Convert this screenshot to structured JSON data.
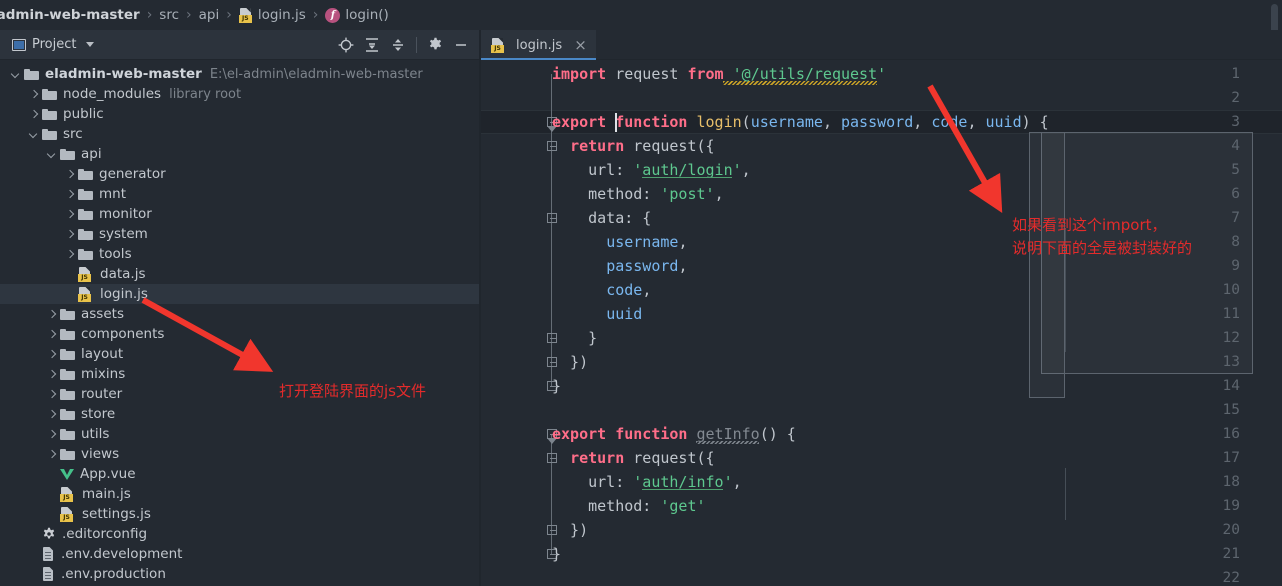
{
  "breadcrumb": {
    "root": "ladmin-web-master",
    "items": [
      "src",
      "api"
    ],
    "file": "login.js",
    "symbol": "login()",
    "separator": "›"
  },
  "project_toolbar": {
    "label": "Project",
    "icons": [
      "locate-icon",
      "expand-all-icon",
      "collapse-all-icon",
      "settings-gear-icon",
      "minimize-icon"
    ]
  },
  "tree": [
    {
      "indent": 0,
      "arrow": "down",
      "icon": "folder",
      "label": "eladmin-web-master",
      "bold": true,
      "sub": "E:\\el-admin\\eladmin-web-master",
      "selected": false
    },
    {
      "indent": 1,
      "arrow": "right",
      "icon": "folder",
      "label": "node_modules",
      "bold": false,
      "sub": "library root",
      "selected": false
    },
    {
      "indent": 1,
      "arrow": "right",
      "icon": "folder",
      "label": "public",
      "bold": false,
      "sub": "",
      "selected": false
    },
    {
      "indent": 1,
      "arrow": "down",
      "icon": "folder",
      "label": "src",
      "bold": false,
      "sub": "",
      "selected": false
    },
    {
      "indent": 2,
      "arrow": "down",
      "icon": "folder",
      "label": "api",
      "bold": false,
      "sub": "",
      "selected": false
    },
    {
      "indent": 3,
      "arrow": "right",
      "icon": "folder",
      "label": "generator",
      "bold": false,
      "sub": "",
      "selected": false
    },
    {
      "indent": 3,
      "arrow": "right",
      "icon": "folder",
      "label": "mnt",
      "bold": false,
      "sub": "",
      "selected": false
    },
    {
      "indent": 3,
      "arrow": "right",
      "icon": "folder",
      "label": "monitor",
      "bold": false,
      "sub": "",
      "selected": false
    },
    {
      "indent": 3,
      "arrow": "right",
      "icon": "folder",
      "label": "system",
      "bold": false,
      "sub": "",
      "selected": false
    },
    {
      "indent": 3,
      "arrow": "right",
      "icon": "folder",
      "label": "tools",
      "bold": false,
      "sub": "",
      "selected": false
    },
    {
      "indent": 3,
      "arrow": "none",
      "icon": "js",
      "label": "data.js",
      "bold": false,
      "sub": "",
      "selected": false
    },
    {
      "indent": 3,
      "arrow": "none",
      "icon": "js",
      "label": "login.js",
      "bold": false,
      "sub": "",
      "selected": true
    },
    {
      "indent": 2,
      "arrow": "right",
      "icon": "folder",
      "label": "assets",
      "bold": false,
      "sub": "",
      "selected": false
    },
    {
      "indent": 2,
      "arrow": "right",
      "icon": "folder",
      "label": "components",
      "bold": false,
      "sub": "",
      "selected": false
    },
    {
      "indent": 2,
      "arrow": "right",
      "icon": "folder",
      "label": "layout",
      "bold": false,
      "sub": "",
      "selected": false
    },
    {
      "indent": 2,
      "arrow": "right",
      "icon": "folder",
      "label": "mixins",
      "bold": false,
      "sub": "",
      "selected": false
    },
    {
      "indent": 2,
      "arrow": "right",
      "icon": "folder",
      "label": "router",
      "bold": false,
      "sub": "",
      "selected": false
    },
    {
      "indent": 2,
      "arrow": "right",
      "icon": "folder",
      "label": "store",
      "bold": false,
      "sub": "",
      "selected": false
    },
    {
      "indent": 2,
      "arrow": "right",
      "icon": "folder",
      "label": "utils",
      "bold": false,
      "sub": "",
      "selected": false
    },
    {
      "indent": 2,
      "arrow": "right",
      "icon": "folder",
      "label": "views",
      "bold": false,
      "sub": "",
      "selected": false
    },
    {
      "indent": 2,
      "arrow": "none",
      "icon": "vue",
      "label": "App.vue",
      "bold": false,
      "sub": "",
      "selected": false
    },
    {
      "indent": 2,
      "arrow": "none",
      "icon": "js",
      "label": "main.js",
      "bold": false,
      "sub": "",
      "selected": false
    },
    {
      "indent": 2,
      "arrow": "none",
      "icon": "js",
      "label": "settings.js",
      "bold": false,
      "sub": "",
      "selected": false
    },
    {
      "indent": 1,
      "arrow": "none",
      "icon": "gear",
      "label": ".editorconfig",
      "bold": false,
      "sub": "",
      "selected": false
    },
    {
      "indent": 1,
      "arrow": "none",
      "icon": "txt",
      "label": ".env.development",
      "bold": false,
      "sub": "",
      "selected": false
    },
    {
      "indent": 1,
      "arrow": "none",
      "icon": "txt",
      "label": ".env.production",
      "bold": false,
      "sub": "",
      "selected": false
    }
  ],
  "editor": {
    "tab": {
      "title": "login.js",
      "close": "×"
    },
    "current_line": 3,
    "lines": [
      {
        "n": 1,
        "tokens": [
          {
            "t": "import",
            "c": "k"
          },
          {
            "t": " request ",
            "c": "id"
          },
          {
            "t": "from",
            "c": "k"
          },
          {
            "t": " ",
            "c": "id"
          },
          {
            "t": "'@/utils/request'",
            "c": "s"
          }
        ]
      },
      {
        "n": 2,
        "tokens": []
      },
      {
        "n": 3,
        "tokens": [
          {
            "t": "export",
            "c": "k"
          },
          {
            "t": " ",
            "c": "id"
          },
          {
            "t": "function",
            "c": "k"
          },
          {
            "t": " ",
            "c": "id"
          },
          {
            "t": "login",
            "c": "fn"
          },
          {
            "t": "(",
            "c": "punct"
          },
          {
            "t": "username",
            "c": "p"
          },
          {
            "t": ", ",
            "c": "punct"
          },
          {
            "t": "password",
            "c": "p"
          },
          {
            "t": ", ",
            "c": "punct"
          },
          {
            "t": "code",
            "c": "p"
          },
          {
            "t": ", ",
            "c": "punct"
          },
          {
            "t": "uuid",
            "c": "p"
          },
          {
            "t": ") {",
            "c": "punct"
          }
        ]
      },
      {
        "n": 4,
        "tokens": [
          {
            "t": "  ",
            "c": "id"
          },
          {
            "t": "return",
            "c": "k"
          },
          {
            "t": " request({",
            "c": "id"
          }
        ]
      },
      {
        "n": 5,
        "tokens": [
          {
            "t": "    url: ",
            "c": "id"
          },
          {
            "t": "'auth/login'",
            "c": "s"
          },
          {
            "t": ",",
            "c": "punct"
          }
        ]
      },
      {
        "n": 6,
        "tokens": [
          {
            "t": "    method: ",
            "c": "id"
          },
          {
            "t": "'post'",
            "c": "s"
          },
          {
            "t": ",",
            "c": "punct"
          }
        ]
      },
      {
        "n": 7,
        "tokens": [
          {
            "t": "    data: {",
            "c": "id"
          }
        ]
      },
      {
        "n": 8,
        "tokens": [
          {
            "t": "      ",
            "c": "id"
          },
          {
            "t": "username",
            "c": "p"
          },
          {
            "t": ",",
            "c": "punct"
          }
        ]
      },
      {
        "n": 9,
        "tokens": [
          {
            "t": "      ",
            "c": "id"
          },
          {
            "t": "password",
            "c": "p"
          },
          {
            "t": ",",
            "c": "punct"
          }
        ]
      },
      {
        "n": 10,
        "tokens": [
          {
            "t": "      ",
            "c": "id"
          },
          {
            "t": "code",
            "c": "p"
          },
          {
            "t": ",",
            "c": "punct"
          }
        ]
      },
      {
        "n": 11,
        "tokens": [
          {
            "t": "      ",
            "c": "id"
          },
          {
            "t": "uuid",
            "c": "p"
          }
        ]
      },
      {
        "n": 12,
        "tokens": [
          {
            "t": "    }",
            "c": "punct"
          }
        ]
      },
      {
        "n": 13,
        "tokens": [
          {
            "t": "  })",
            "c": "punct"
          }
        ]
      },
      {
        "n": 14,
        "tokens": [
          {
            "t": "}",
            "c": "punct"
          }
        ]
      },
      {
        "n": 15,
        "tokens": []
      },
      {
        "n": 16,
        "tokens": [
          {
            "t": "export",
            "c": "k"
          },
          {
            "t": " ",
            "c": "id"
          },
          {
            "t": "function",
            "c": "k"
          },
          {
            "t": " ",
            "c": "id"
          },
          {
            "t": "getInfo",
            "c": "gray"
          },
          {
            "t": "() {",
            "c": "punct"
          }
        ]
      },
      {
        "n": 17,
        "tokens": [
          {
            "t": "  ",
            "c": "id"
          },
          {
            "t": "return",
            "c": "k"
          },
          {
            "t": " request({",
            "c": "id"
          }
        ]
      },
      {
        "n": 18,
        "tokens": [
          {
            "t": "    url: ",
            "c": "id"
          },
          {
            "t": "'auth/info'",
            "c": "s"
          },
          {
            "t": ",",
            "c": "punct"
          }
        ]
      },
      {
        "n": 19,
        "tokens": [
          {
            "t": "    method: ",
            "c": "id"
          },
          {
            "t": "'get'",
            "c": "s"
          }
        ]
      },
      {
        "n": 20,
        "tokens": [
          {
            "t": "  })",
            "c": "punct"
          }
        ]
      },
      {
        "n": 21,
        "tokens": [
          {
            "t": "}",
            "c": "punct"
          }
        ]
      },
      {
        "n": 22,
        "tokens": []
      }
    ]
  },
  "annotations": [
    {
      "id": "anno-import",
      "text": "如果看到这个import，\n说明下面的全是被封装好的",
      "color": "#e42b2b"
    },
    {
      "id": "anno-login-file",
      "text": "打开登陆界面的js文件",
      "color": "#e42b2b"
    }
  ],
  "colors": {
    "annotation_red": "#e42b2b",
    "keyword_pink": "#ff6e89",
    "string_green": "#5ec88f",
    "param_blue": "#7ab7ef",
    "function_orange": "#e8bf6a",
    "editor_bg": "#242a32",
    "tab_accent": "#4a88c7"
  }
}
